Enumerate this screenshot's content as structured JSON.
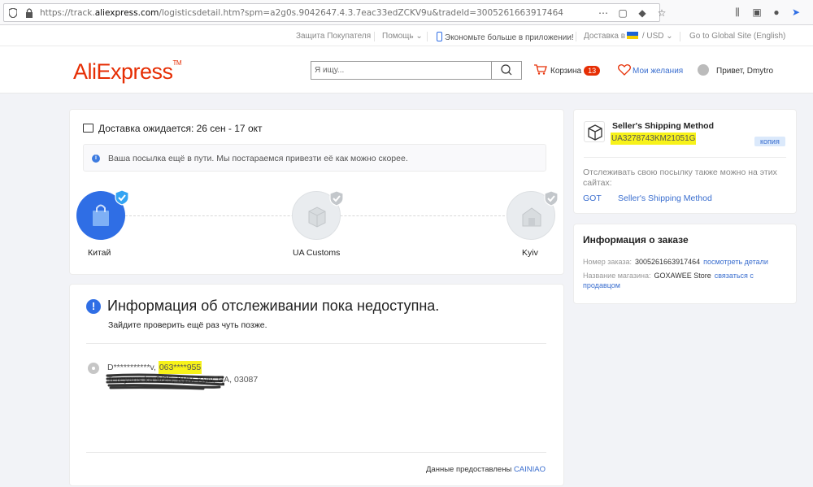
{
  "browser": {
    "url_prefix": "https://track.",
    "url_domain": "aliexpress.com",
    "url_rest": "/logisticsdetail.htm?spm=a2g0s.9042647.4.3.7eac33edZCKV9u&tradeId=3005261663917464",
    "url_icons": [
      "ellipsis-icon",
      "pocket-icon",
      "extension-icon",
      "bookmark-star-icon"
    ],
    "right_icons": [
      "library-icon",
      "sidebar-icon",
      "account-icon",
      "cursor-icon"
    ]
  },
  "top_nav": {
    "buyer_protection": "Защита Покупателя",
    "help": "Помощь",
    "app_promo": "Экономьте больше в приложении!",
    "ship_to": "Доставка в",
    "currency": "USD",
    "global_site": "Go to Global Site (English)"
  },
  "header": {
    "logo": "AliExpress",
    "logo_tm": "TM",
    "search_placeholder": "Я ищу...",
    "cart_label": "Корзина",
    "cart_count": "13",
    "wishlist_label": "Мои желания",
    "greeting": "Привет, Dmytro"
  },
  "delivery": {
    "title": "Доставка ожидается: 26 сен - 17 окт",
    "notice": "Ваша посылка ещё в пути. Мы постараемся привезти её как можно скорее.",
    "route": [
      {
        "label": "Китай",
        "state": "active"
      },
      {
        "label": "UA Customs",
        "state": "inactive"
      },
      {
        "label": "Kyiv",
        "state": "inactive"
      }
    ]
  },
  "tracking": {
    "heading": "Информация об отслеживании пока недоступна.",
    "subheading": "Зайдите проверить ещё раз чуть позже.",
    "recipient_name": "D***********v,",
    "recipient_phone": "063****955",
    "address_hidden": "Tereyans ka 9/25, Kyiv, Kyiv,",
    "address_visible": "UA,  03087",
    "provided_by": "Данные предоставлены",
    "provider": "CAINIAO"
  },
  "shipping": {
    "method": "Seller's Shipping Method",
    "tracking_number": "UA3278743KM21051G",
    "copy_label": "копия",
    "also_track": "Отслеживать свою посылку также можно на этих сайтах:",
    "links": [
      "GOT",
      "Seller's Shipping Method"
    ]
  },
  "order": {
    "title": "Информация о заказе",
    "number_label": "Номер заказа:",
    "number_value": "3005261663917464",
    "details_link": "посмотреть детали",
    "store_label": "Название магазина:",
    "store_value": "GOXAWEE Store",
    "contact_link_1": "связаться с",
    "contact_link_2": "продавцом"
  },
  "colors": {
    "brand": "#e62e04",
    "accent_blue": "#2f6ee5",
    "highlight": "#f7f21a"
  }
}
